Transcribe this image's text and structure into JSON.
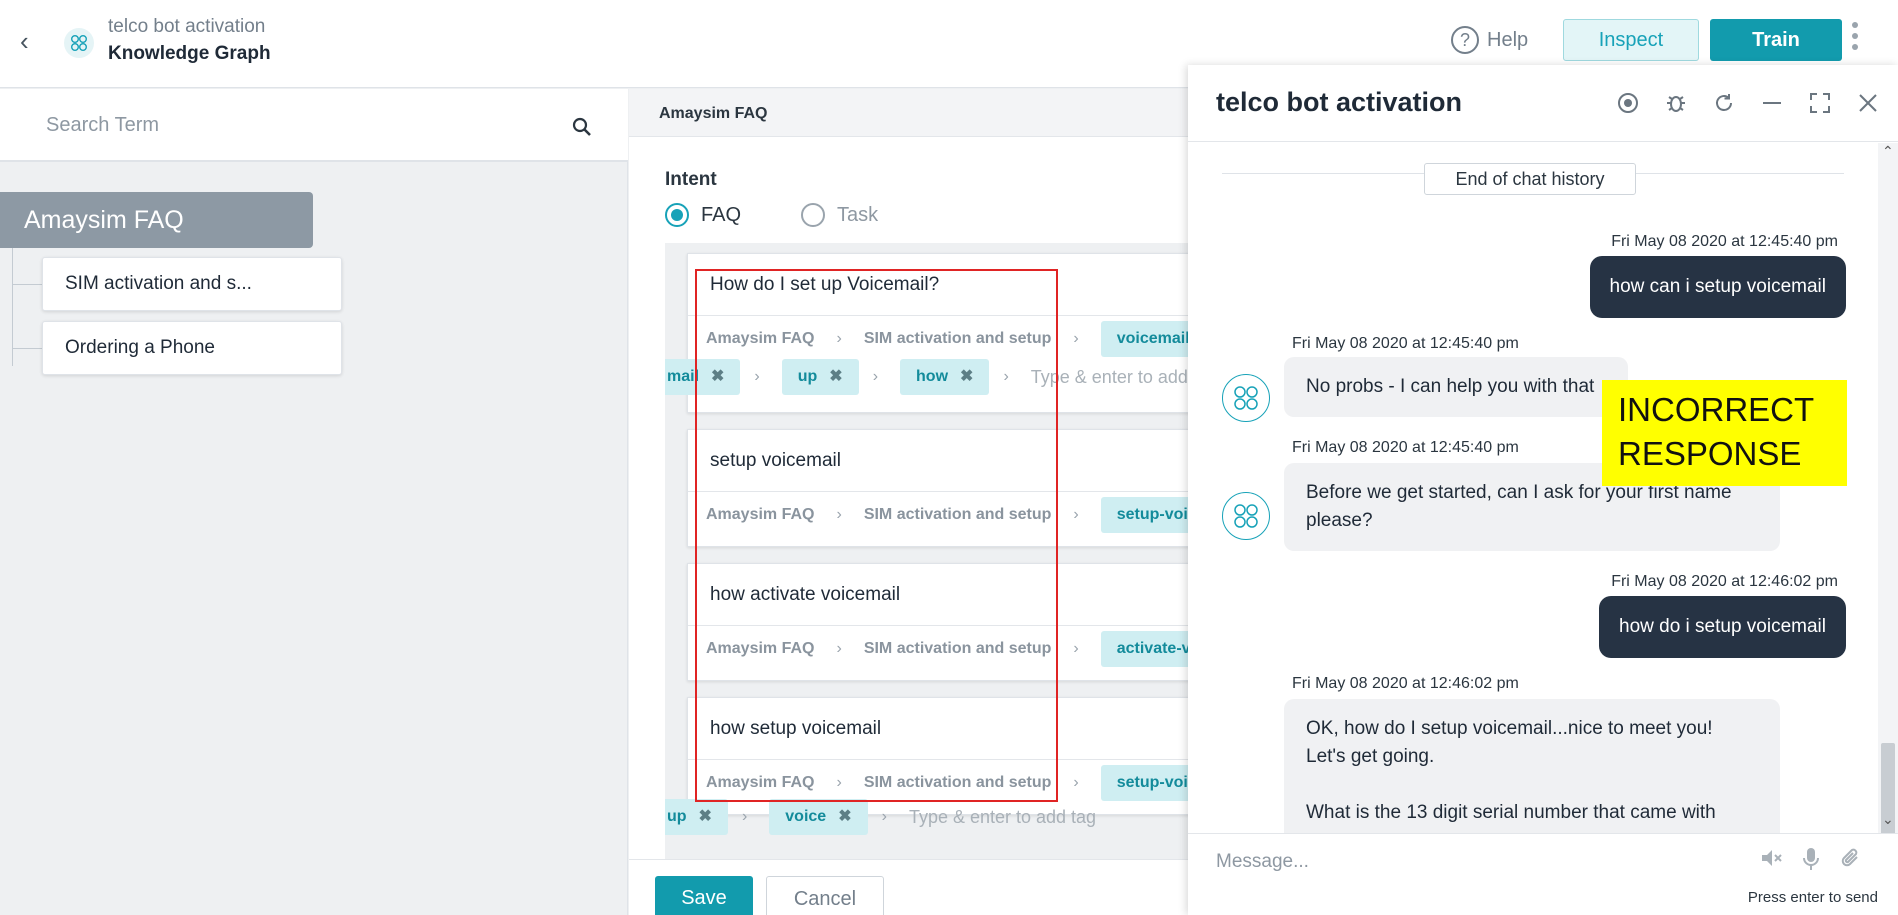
{
  "header": {
    "app_name": "telco bot activation",
    "page_title": "Knowledge Graph",
    "help_label": "Help",
    "inspect_label": "Inspect",
    "train_label": "Train"
  },
  "left_panel": {
    "search_placeholder": "Search Term",
    "root_node": "Amaysim FAQ",
    "children": [
      "SIM activation and s...",
      "Ordering a Phone"
    ]
  },
  "middle_panel": {
    "header_title": "Amaysim FAQ",
    "intent_label": "Intent",
    "radio_faq": "FAQ",
    "radio_task": "Task",
    "utterances": [
      {
        "question": "How do I set up Voicemail?",
        "crumbs": [
          "Amaysim FAQ",
          "SIM activation and setup"
        ],
        "tag": "voicemail",
        "extra_tags": [
          "mail",
          "up",
          "how"
        ],
        "tag_hint": "Type & enter to add ta"
      },
      {
        "question": "setup voicemail",
        "crumbs": [
          "Amaysim FAQ",
          "SIM activation and setup"
        ],
        "tag": "setup-voic"
      },
      {
        "question": "how activate voicemail",
        "crumbs": [
          "Amaysim FAQ",
          "SIM activation and setup"
        ],
        "tag": "activate-vo"
      },
      {
        "question": "how setup voicemail",
        "crumbs": [
          "Amaysim FAQ",
          "SIM activation and setup"
        ],
        "tag": "setup-voic",
        "extra_tags": [
          "up",
          "voice"
        ],
        "tag_hint": "Type & enter to add tag"
      }
    ],
    "save_label": "Save",
    "cancel_label": "Cancel"
  },
  "chat": {
    "title": "telco bot activation",
    "history_label": "End of chat history",
    "messages": [
      {
        "from": "user",
        "time": "Fri May 08 2020 at 12:45:40 pm",
        "text": "how can i setup voicemail"
      },
      {
        "from": "bot",
        "time": "Fri May 08 2020 at 12:45:40 pm",
        "text": "No probs - I can help you with that"
      },
      {
        "from": "bot",
        "time": "Fri May 08 2020 at 12:45:40 pm",
        "text_lines": [
          "Before we get started, can I ask for your first name",
          "please?"
        ]
      },
      {
        "from": "user",
        "time": "Fri May 08 2020 at 12:46:02 pm",
        "text": "how do i setup voicemail"
      },
      {
        "from": "bot",
        "time": "Fri May 08 2020 at 12:46:02 pm",
        "text_lines": [
          "OK, how do I setup voicemail...nice to meet you!",
          "Let's get going.",
          "",
          "What is the 13 digit serial number that came with"
        ]
      }
    ],
    "message_placeholder": "Message...",
    "press_enter": "Press enter to send"
  },
  "annotation": {
    "line1": "INCORRECT",
    "line2": "RESPONSE"
  },
  "colors": {
    "accent": "#129bad",
    "user_bubble": "#263344",
    "annotation_bg": "#ffff00",
    "highlight_box": "#e02424"
  }
}
